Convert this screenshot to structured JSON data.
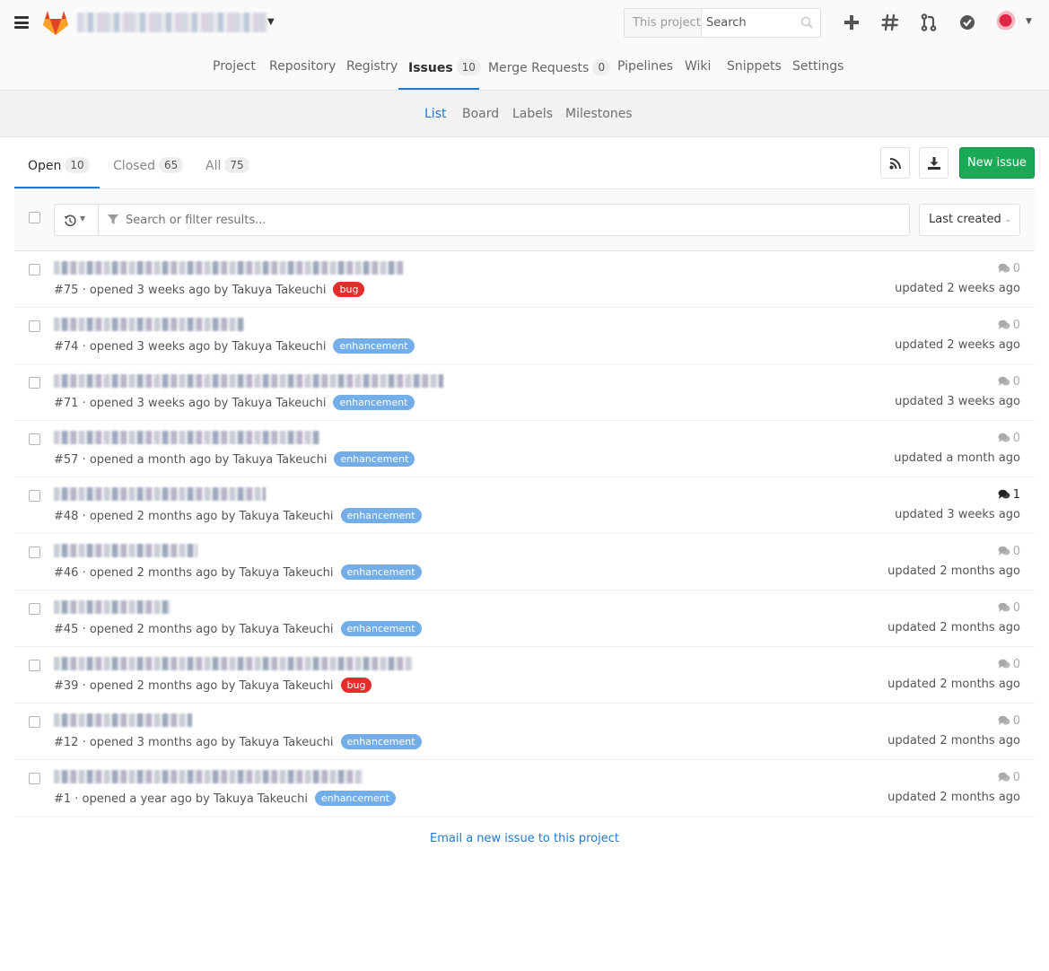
{
  "colors": {
    "accent": "#1f78d1",
    "success": "#1aaa55",
    "bug": "#e82b2b",
    "enhancement": "#74aee9"
  },
  "header": {
    "search": {
      "scope": "This project",
      "placeholder": "Search"
    }
  },
  "project_nav": {
    "tabs": [
      {
        "label": "Project"
      },
      {
        "label": "Repository"
      },
      {
        "label": "Registry"
      },
      {
        "label": "Issues",
        "count": "10",
        "active": true
      },
      {
        "label": "Merge Requests",
        "count": "0"
      },
      {
        "label": "Pipelines"
      },
      {
        "label": "Wiki"
      },
      {
        "label": "Snippets"
      },
      {
        "label": "Settings"
      }
    ]
  },
  "sub_nav": {
    "tabs": [
      {
        "label": "List",
        "active": true
      },
      {
        "label": "Board"
      },
      {
        "label": "Labels"
      },
      {
        "label": "Milestones"
      }
    ]
  },
  "state_tabs": [
    {
      "label": "Open",
      "count": "10",
      "active": true
    },
    {
      "label": "Closed",
      "count": "65"
    },
    {
      "label": "All",
      "count": "75"
    }
  ],
  "actions": {
    "new_issue": "New issue"
  },
  "filter": {
    "placeholder": "Search or filter results...",
    "sort": "Last created"
  },
  "issues": [
    {
      "meta": "#75 · opened 3 weeks ago by Takuya Takeuchi",
      "label": "bug",
      "comments": "0",
      "updated": "updated 2 weeks ago"
    },
    {
      "meta": "#74 · opened 3 weeks ago by Takuya Takeuchi",
      "label": "enhancement",
      "comments": "0",
      "updated": "updated 2 weeks ago"
    },
    {
      "meta": "#71 · opened 3 weeks ago by Takuya Takeuchi",
      "label": "enhancement",
      "comments": "0",
      "updated": "updated 3 weeks ago"
    },
    {
      "meta": "#57 · opened a month ago by Takuya Takeuchi",
      "label": "enhancement",
      "comments": "0",
      "updated": "updated a month ago"
    },
    {
      "meta": "#48 · opened 2 months ago by Takuya Takeuchi",
      "label": "enhancement",
      "comments": "1",
      "updated": "updated 3 weeks ago"
    },
    {
      "meta": "#46 · opened 2 months ago by Takuya Takeuchi",
      "label": "enhancement",
      "comments": "0",
      "updated": "updated 2 months ago"
    },
    {
      "meta": "#45 · opened 2 months ago by Takuya Takeuchi",
      "label": "enhancement",
      "comments": "0",
      "updated": "updated 2 months ago"
    },
    {
      "meta": "#39 · opened 2 months ago by Takuya Takeuchi",
      "label": "bug",
      "comments": "0",
      "updated": "updated 2 months ago"
    },
    {
      "meta": "#12 · opened 3 months ago by Takuya Takeuchi",
      "label": "enhancement",
      "comments": "0",
      "updated": "updated 2 months ago"
    },
    {
      "meta": "#1 · opened a year ago by Takuya Takeuchi",
      "label": "enhancement",
      "comments": "0",
      "updated": "updated 2 months ago"
    }
  ],
  "footer": {
    "email_link": "Email a new issue to this project"
  }
}
